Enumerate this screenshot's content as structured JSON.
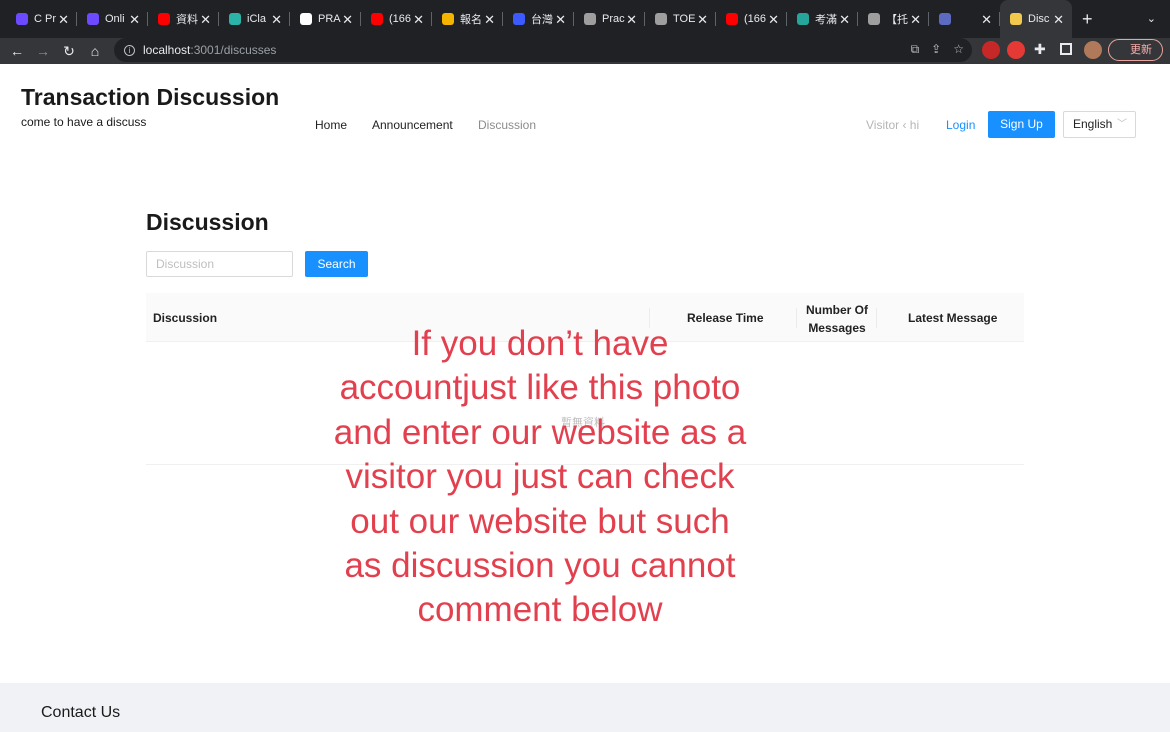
{
  "browser": {
    "tabs": [
      {
        "title": "C Pr",
        "favicon_color": "#6d4aff"
      },
      {
        "title": "Onli",
        "favicon_color": "#6d4aff"
      },
      {
        "title": "資料",
        "favicon_color": "#ff0000"
      },
      {
        "title": "iCla",
        "favicon_color": "#2ab3a6"
      },
      {
        "title": "PRA",
        "favicon_color": "#ffffff"
      },
      {
        "title": "(166",
        "favicon_color": "#ff0000"
      },
      {
        "title": "報名",
        "favicon_color": "#f4b400"
      },
      {
        "title": "台灣",
        "favicon_color": "#3d5afe"
      },
      {
        "title": "Prac",
        "favicon_color": "#9e9e9e"
      },
      {
        "title": "TOE",
        "favicon_color": "#9e9e9e"
      },
      {
        "title": "(166",
        "favicon_color": "#ff0000"
      },
      {
        "title": "考滿",
        "favicon_color": "#26a69a"
      },
      {
        "title": "【托",
        "favicon_color": "#9e9e9e"
      },
      {
        "title": "",
        "favicon_color": "#5c6bc0"
      }
    ],
    "active_tab": {
      "title": "Disc",
      "favicon_color": "#f2c94c"
    },
    "new_tab_label": "+",
    "url_host": "localhost",
    "url_path": ":3001/discusses",
    "update_label": "更新"
  },
  "site": {
    "title": "Transaction Discussion",
    "subtitle": "come to have a discuss",
    "nav": [
      "Home",
      "Announcement",
      "Discussion"
    ],
    "visitor_text": "Visitor ‹ hi",
    "login_label": "Login",
    "signup_label": "Sign Up",
    "language": "English"
  },
  "main": {
    "heading": "Discussion",
    "search_placeholder": "Discussion",
    "search_button": "Search",
    "columns": [
      "Discussion",
      "Release Time",
      "Number Of Messages",
      "Latest Message"
    ],
    "empty_text": "暫無資料"
  },
  "footer": {
    "title": "Contact Us"
  },
  "overlay_text": "If you don’t have accountjust like this photo and enter our website as a visitor you just can check out our website but such as discussion you cannot comment below",
  "colors": {
    "primary": "#1890ff",
    "overlay_text": "#e2404e",
    "chrome_dark": "#202124"
  }
}
